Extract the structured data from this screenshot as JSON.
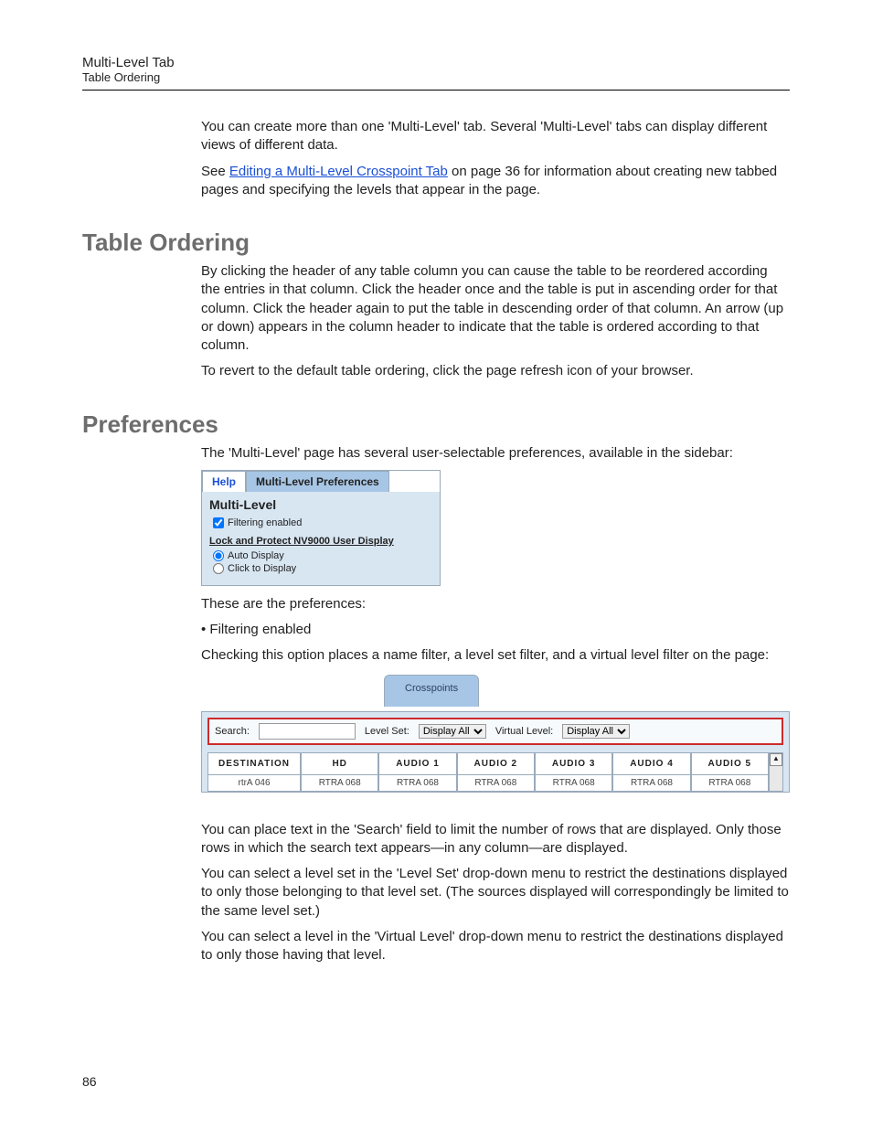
{
  "header": {
    "line1": "Multi-Level Tab",
    "line2": "Table Ordering"
  },
  "intro": {
    "p1": "You can create more than one 'Multi-Level' tab. Several 'Multi-Level' tabs can display different views of different data.",
    "p2_pre": "See ",
    "p2_link": "Editing a Multi-Level Crosspoint Tab",
    "p2_post": " on page 36 for information about creating new tabbed pages and specifying the levels that appear in the page."
  },
  "ordering": {
    "heading": "Table Ordering",
    "p1": "By clicking the header of any table column you can cause the table to be reordered according the entries in that column. Click the header once and the table is put in ascending order for that column. Click the header again to put the table in descending order of that column. An arrow (up or down) appears in the column header to indicate that the table is ordered according to that column.",
    "p2": "To revert to the default table ordering, click the page refresh icon of your browser."
  },
  "prefs": {
    "heading": "Preferences",
    "intro": "The 'Multi-Level' page has several user-selectable preferences, available in the sidebar:",
    "panel": {
      "tab_help": "Help",
      "tab_active": "Multi-Level Preferences",
      "title": "Multi-Level",
      "check_filtering": "Filtering enabled",
      "subhead": "Lock and Protect NV9000 User Display",
      "radio_auto": "Auto Display",
      "radio_click": "Click to Display"
    },
    "lead": "These are the preferences:",
    "bullet_filtering": "Filtering enabled",
    "filtering_desc": "Checking this option places a name filter, a level set filter, and a virtual level filter on the page:",
    "cp": {
      "tab": "Crosspoints",
      "search_label": "Search:",
      "levelset_label": "Level Set:",
      "virtual_label": "Virtual Level:",
      "dd_value": "Display All",
      "columns": [
        "DESTINATION",
        "HD",
        "AUDIO 1",
        "AUDIO 2",
        "AUDIO 3",
        "AUDIO 4",
        "AUDIO 5"
      ],
      "row1": [
        "rtrA 046",
        "RTRA 068",
        "RTRA 068",
        "RTRA 068",
        "RTRA 068",
        "RTRA 068",
        "RTRA 068"
      ]
    },
    "p_search": "You can place text in the 'Search' field to limit the number of rows that are displayed. Only those rows in which the search text appears—in any column—are displayed.",
    "p_levelset": "You can select a level set in the 'Level Set' drop-down menu to restrict the destinations displayed to only those belonging to that level set. (The sources displayed will correspondingly be limited to the same level set.)",
    "p_virtual": "You can select a level in the 'Virtual Level' drop-down menu to restrict the destinations displayed to only those having that level."
  },
  "page_number": "86"
}
